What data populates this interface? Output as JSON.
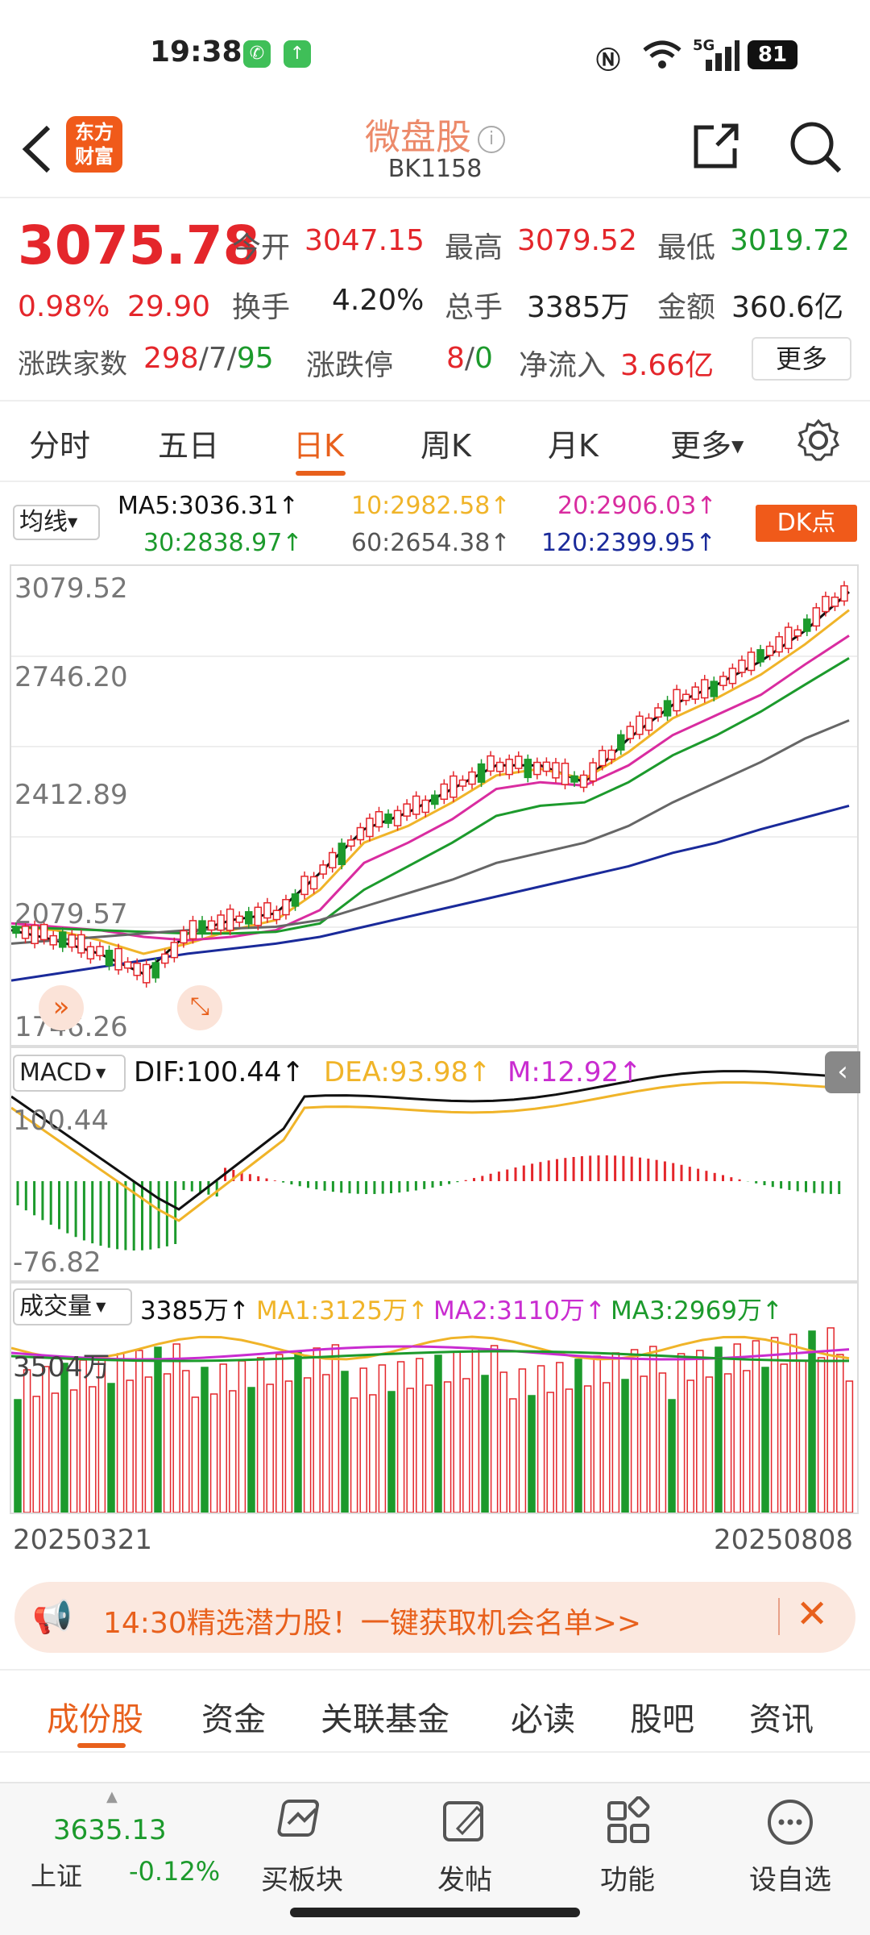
{
  "status_bar": {
    "time": "19:38",
    "battery": "81",
    "network": "5G"
  },
  "header": {
    "logo_text": "东方\n财富",
    "title": "微盘股",
    "code": "BK1158",
    "info_symbol": "i"
  },
  "quote": {
    "price": "3075.78",
    "change_pct": "0.98%",
    "change": "29.90",
    "open_label": "今开",
    "open": "3047.15",
    "high_label": "最高",
    "high": "3079.52",
    "low_label": "最低",
    "low": "3019.72",
    "turnover_label": "换手",
    "turnover": "4.20%",
    "volume_label": "总手",
    "volume": "3385万",
    "amount_label": "金额",
    "amount": "360.6亿",
    "breadth_label": "涨跌家数",
    "breadth_up": "298",
    "breadth_sep1": "/",
    "breadth_flat": "7",
    "breadth_sep2": "/",
    "breadth_down": "95",
    "limit_label": "涨跌停",
    "limit_up": "8",
    "limit_sep": "/",
    "limit_down": "0",
    "netflow_label": "净流入",
    "netflow": "3.66亿",
    "more": "更多"
  },
  "period_tabs": [
    "分时",
    "五日",
    "日K",
    "周K",
    "月K",
    "更多"
  ],
  "active_period": 2,
  "ma_row": {
    "selector": "均线",
    "ma5": "MA5:3036.31",
    "ma10": "10:2982.58",
    "ma20": "20:2906.03",
    "ma30": "30:2838.97",
    "ma60": "60:2654.38",
    "ma120": "120:2399.95",
    "arrow": "↑",
    "dk": "DK点"
  },
  "colors": {
    "up": "#e4262b",
    "down": "#1c9a2c",
    "accent": "#e8601c",
    "ma5": "#111111",
    "ma10": "#f0b429",
    "ma20": "#d92ca0",
    "ma30": "#1c9a2c",
    "ma60": "#666666",
    "ma120": "#1a2a9a"
  },
  "kline": {
    "y_top": "3079.52",
    "y_2": "2746.20",
    "y_3": "2412.89",
    "y_4": "2079.57",
    "y_bottom": "1746.26"
  },
  "macd": {
    "selector": "MACD",
    "dif": "DIF:100.44",
    "dea": "DEA:93.98",
    "m": "M:12.92",
    "arrow": "↑",
    "y_top": "100.44",
    "y_bottom": "-76.82"
  },
  "volume": {
    "selector": "成交量",
    "vol": "3385万",
    "ma1": "MA1:3125万",
    "ma2": "MA2:3110万",
    "ma3": "MA3:2969万",
    "arrow": "↑",
    "y_top": "3504万"
  },
  "dates": {
    "start": "20250321",
    "end": "20250808"
  },
  "banner": {
    "text": "14:30精选潜力股！一键获取机会名单>>"
  },
  "lower_tabs": [
    "成份股",
    "资金",
    "关联基金",
    "必读",
    "股吧",
    "资讯"
  ],
  "toolbar": {
    "index_value": "3635.13",
    "index_name": "上证",
    "index_change": "-0.12%",
    "items": [
      "买板块",
      "发帖",
      "功能",
      "设自选"
    ]
  },
  "chart_data": [
    {
      "type": "line",
      "title": "",
      "x": [
        "20250321",
        "20250808"
      ],
      "ylim": [
        1746.26,
        3079.52
      ],
      "series": [
        {
          "name": "MA5",
          "values": [
            2030,
            2000,
            1960,
            1900,
            2020,
            2060,
            2080,
            2200,
            2330,
            2380,
            2450,
            2520,
            2520,
            2470,
            2600,
            2700,
            2760,
            2830,
            2920,
            3036
          ]
        },
        {
          "name": "MA10",
          "values": [
            2040,
            2030,
            2000,
            1960,
            1990,
            2030,
            2060,
            2150,
            2290,
            2340,
            2410,
            2490,
            2510,
            2480,
            2560,
            2660,
            2720,
            2790,
            2880,
            2982
          ]
        },
        {
          "name": "MA20",
          "values": [
            2050,
            2040,
            2030,
            2010,
            2000,
            2010,
            2030,
            2090,
            2230,
            2290,
            2360,
            2450,
            2470,
            2460,
            2520,
            2610,
            2670,
            2730,
            2820,
            2906
          ]
        },
        {
          "name": "MA30",
          "values": [
            2040,
            2035,
            2030,
            2025,
            2020,
            2020,
            2025,
            2050,
            2150,
            2220,
            2290,
            2370,
            2400,
            2410,
            2470,
            2550,
            2610,
            2680,
            2760,
            2839
          ]
        },
        {
          "name": "MA60",
          "values": [
            1990,
            2000,
            2010,
            2020,
            2030,
            2035,
            2040,
            2060,
            2100,
            2140,
            2180,
            2230,
            2260,
            2290,
            2340,
            2410,
            2470,
            2530,
            2600,
            2654
          ]
        },
        {
          "name": "MA120",
          "values": [
            1880,
            1900,
            1920,
            1940,
            1960,
            1975,
            1990,
            2010,
            2040,
            2070,
            2100,
            2130,
            2160,
            2190,
            2220,
            2260,
            2290,
            2330,
            2365,
            2400
          ]
        }
      ]
    }
  ]
}
